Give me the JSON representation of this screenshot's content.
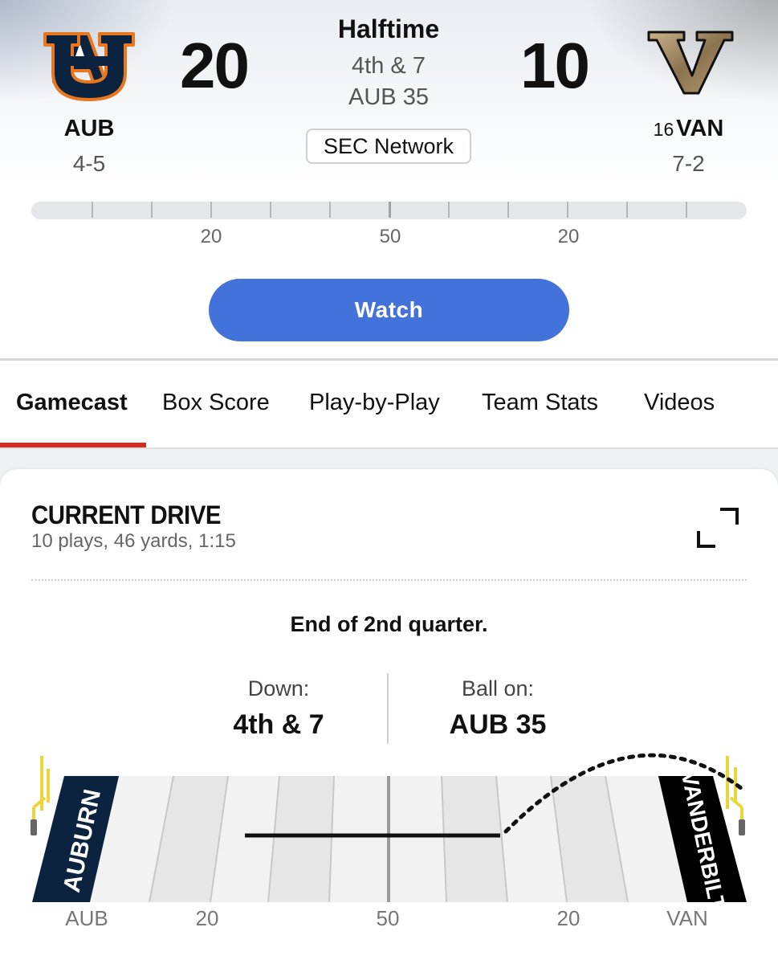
{
  "header": {
    "away": {
      "abbr": "AUB",
      "record": "4-5",
      "score": "20",
      "logo": "auburn-au-logo",
      "color": "#0c2340",
      "accent": "#e87722"
    },
    "home": {
      "rank": "16",
      "abbr": "VAN",
      "record": "7-2",
      "score": "10",
      "logo": "vanderbilt-v-logo",
      "color": "#866d4b"
    },
    "status": "Halftime",
    "down_distance": "4th & 7",
    "ball_spot": "AUB 35",
    "network": "SEC Network",
    "mini_field_labels": [
      "20",
      "50",
      "20"
    ],
    "watch_label": "Watch",
    "watch_color": "#4472db"
  },
  "tabs": [
    {
      "label": "Gamecast",
      "active": true
    },
    {
      "label": "Box Score",
      "active": false
    },
    {
      "label": "Play-by-Play",
      "active": false
    },
    {
      "label": "Team Stats",
      "active": false
    },
    {
      "label": "Videos",
      "active": false
    }
  ],
  "tab_accent": "#d52b1e",
  "drive": {
    "title": "CURRENT DRIVE",
    "summary": "10 plays, 46 yards, 1:15",
    "last_play": "End of 2nd quarter.",
    "down_label": "Down:",
    "down_value": "4th & 7",
    "ball_label": "Ball on:",
    "ball_value": "AUB 35",
    "left_endzone_text": "AUBURN",
    "right_endzone_text": "VANDERBILT",
    "left_endzone_color": "#0c2340",
    "right_endzone_color": "#000000",
    "field_labels": [
      "AUB",
      "20",
      "50",
      "20",
      "VAN"
    ]
  }
}
